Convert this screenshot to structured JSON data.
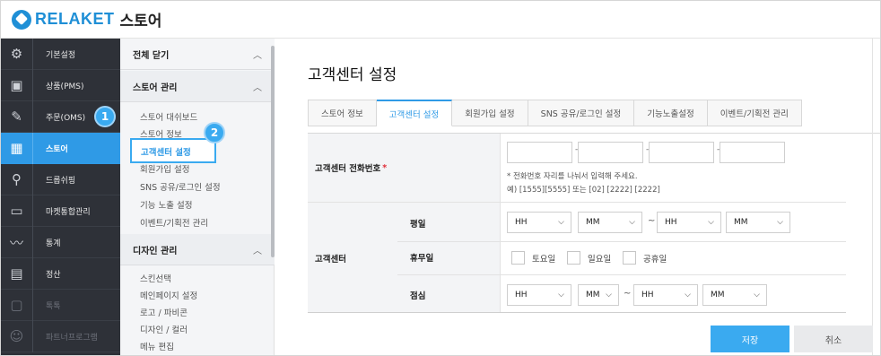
{
  "header": {
    "brand": "RELAKET",
    "store": "스토어"
  },
  "sidebar": {
    "items": [
      {
        "label": "기본설정",
        "icon": "gear-icon"
      },
      {
        "label": "상품(PMS)",
        "icon": "box-icon"
      },
      {
        "label": "주문(OMS)",
        "icon": "order-icon"
      },
      {
        "label": "스토어",
        "icon": "store-icon"
      },
      {
        "label": "드롭쉬핑",
        "icon": "network-icon"
      },
      {
        "label": "마켓통합관리",
        "icon": "monitor-icon"
      },
      {
        "label": "통계",
        "icon": "chart-icon"
      },
      {
        "label": "정산",
        "icon": "calculator-icon"
      },
      {
        "label": "톡톡",
        "icon": "chat-icon"
      },
      {
        "label": "파트너프로그램",
        "icon": "partner-icon"
      }
    ],
    "badge1": "1",
    "active_color": "#2f9ae6"
  },
  "submenu": {
    "close_all": "전체 닫기",
    "store_manage": "스토어 관리",
    "store_links": [
      "스토어 대쉬보드",
      "스토어 정보",
      "고객센터 설정",
      "회원가입 설정",
      "SNS 공유/로그인 설정",
      "기능 노출 설정",
      "이벤트/기획전 관리"
    ],
    "design_manage": "디자인 관리",
    "design_links": [
      "스킨선택",
      "메인페이지 설정",
      "로고 / 파비콘",
      "디자인 / 컬러",
      "메뉴 편집"
    ],
    "badge2": "2"
  },
  "main": {
    "title": "고객센터 설정",
    "tabs": [
      "스토어 정보",
      "고객센터 설정",
      "회원가입 설정",
      "SNS 공유/로그인 설정",
      "기능노출설정",
      "이벤트/기획전 관리"
    ],
    "active_tab": 1,
    "phone_label": "고객센터 전화번호",
    "required_mark": "*",
    "phone_hint1": "* 전화번호 자리를 나눠서 입력해 주세요.",
    "phone_hint2": "예) [1555][5555] 또는 [02] [2222] [2222]",
    "service_label": "고객센터",
    "weekday_label": "평일",
    "holiday_label": "휴무일",
    "lunch_label": "점심",
    "hh": "HH",
    "mm": "MM",
    "tilde": "~",
    "holiday_options": [
      "토요일",
      "일요일",
      "공휴일"
    ],
    "save": "저장",
    "cancel": "취소"
  }
}
